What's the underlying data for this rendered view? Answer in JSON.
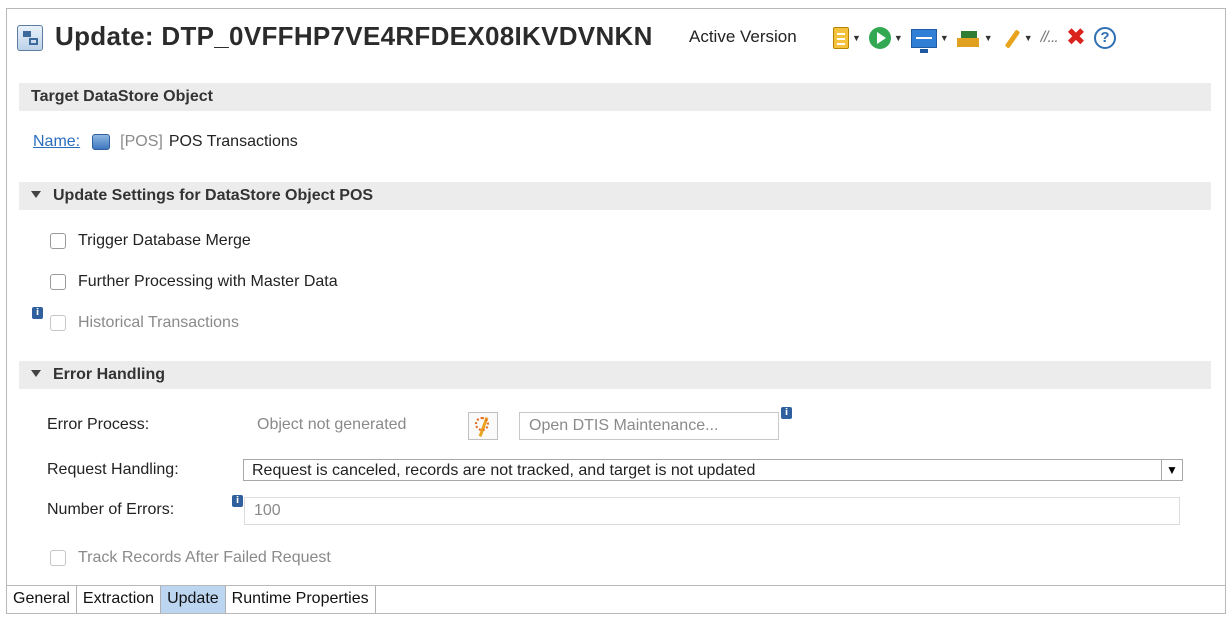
{
  "header": {
    "title": "Update: DTP_0VFFHP7VE4RFDEX08IKVDVNKN",
    "version": "Active Version",
    "toolbar": [
      {
        "icon": "document-icon",
        "dropdown": true
      },
      {
        "icon": "run-icon",
        "dropdown": true
      },
      {
        "icon": "monitor-icon",
        "dropdown": true
      },
      {
        "icon": "stack-icon",
        "dropdown": true
      },
      {
        "icon": "wrench-icon",
        "dropdown": true
      },
      {
        "icon": "dots-icon",
        "text": "//..."
      },
      {
        "icon": "close-icon",
        "text": "✖"
      },
      {
        "icon": "help-icon",
        "text": "?"
      }
    ]
  },
  "target": {
    "section_title": "Target DataStore Object",
    "name_label": "Name:",
    "name_prefix": "[POS]",
    "name_value": "POS Transactions"
  },
  "update_settings": {
    "section_title": "Update Settings for DataStore Object POS",
    "options": [
      {
        "label": "Trigger Database Merge",
        "checked": false,
        "enabled": true
      },
      {
        "label": "Further Processing with Master Data",
        "checked": false,
        "enabled": true
      },
      {
        "label": "Historical Transactions",
        "checked": false,
        "enabled": false
      }
    ]
  },
  "error_handling": {
    "section_title": "Error Handling",
    "error_process_label": "Error Process:",
    "error_process_value": "Object not generated",
    "open_dtis_label": "Open DTIS Maintenance...",
    "request_handling_label": "Request Handling:",
    "request_handling_value": "Request is canceled, records are not tracked, and target is not updated",
    "number_errors_label": "Number of Errors:",
    "number_errors_value": "100",
    "track_records_label": "Track Records After Failed Request",
    "info_glyph": "i"
  },
  "tabs": [
    {
      "label": "General",
      "active": false
    },
    {
      "label": "Extraction",
      "active": false
    },
    {
      "label": "Update",
      "active": true
    },
    {
      "label": "Runtime Properties",
      "active": false
    }
  ],
  "colors": {
    "accent": "#2a6dbd",
    "tab_active": "#bcd6f1",
    "section_bg": "#ececec"
  }
}
